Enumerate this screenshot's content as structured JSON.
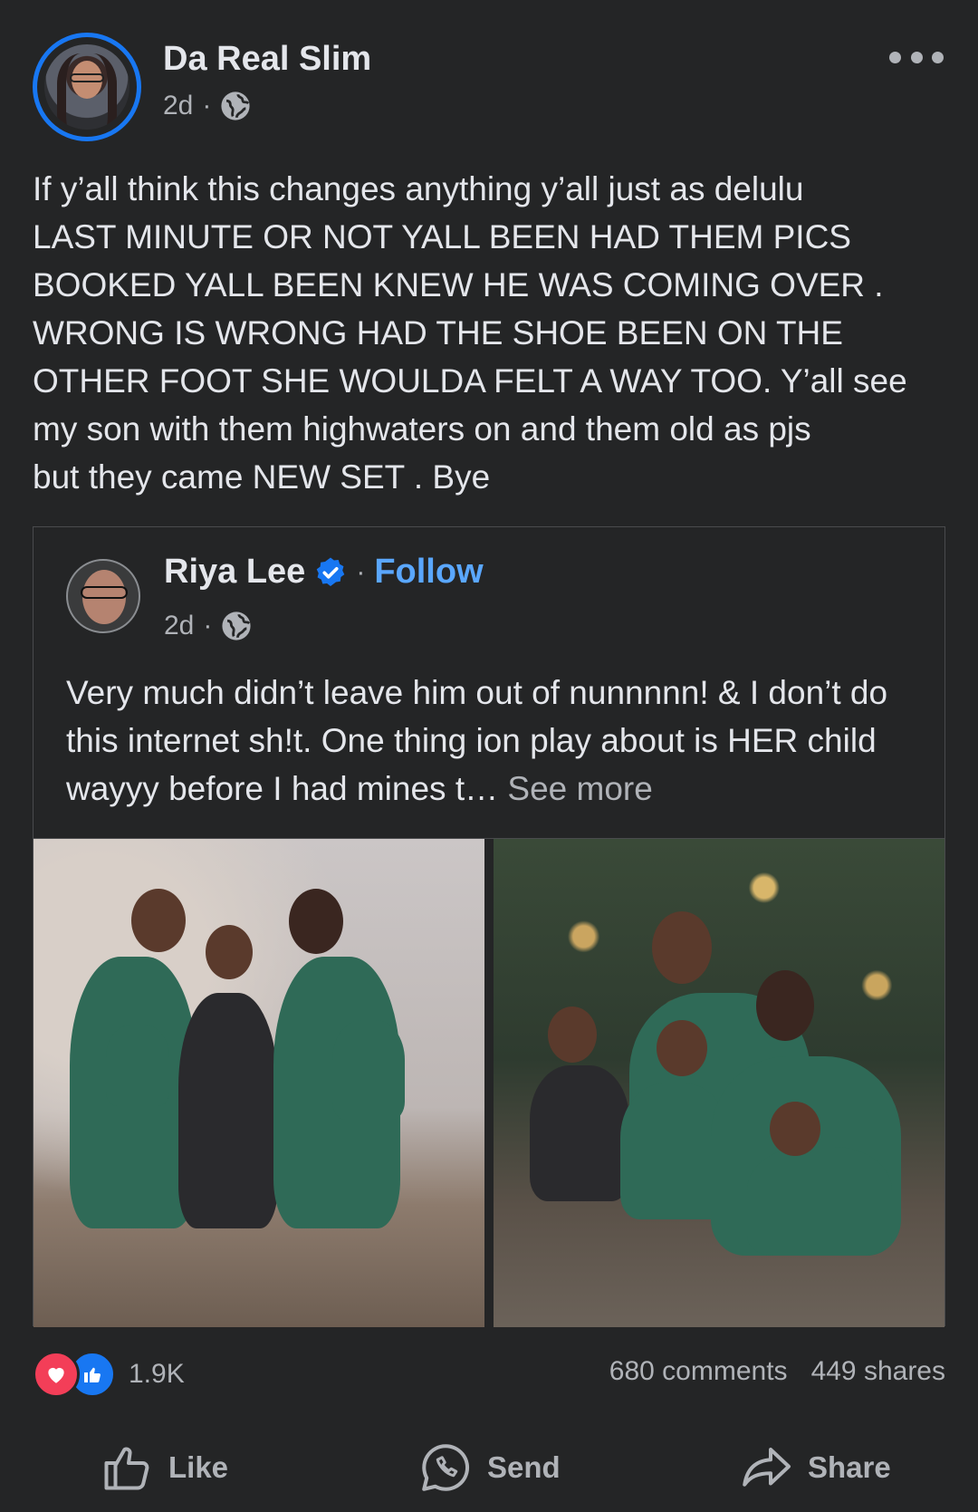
{
  "post": {
    "author": "Da Real Slim",
    "time": "2d",
    "meta_sep": "·",
    "text": "If y’all think this changes anything y’all just as delulu\nLAST MINUTE OR NOT YALL BEEN HAD THEM PICS\nBOOKED YALL BEEN KNEW HE WAS COMING OVER .\nWRONG IS WRONG HAD THE SHOE BEEN ON THE\nOTHER FOOT SHE WOULDA FELT A WAY TOO. Y’all see\nmy son with them highwaters on and them old as pjs\nbut they came NEW SET . Bye"
  },
  "shared": {
    "author": "Riya Lee",
    "separator": "·",
    "follow_label": "Follow",
    "time": "2d",
    "meta_sep": "·",
    "text": "Very much didn’t leave him out of nunnnnn! & I don’t do this internet sh!t. One thing ion play about is HER child wayyy before I had mines t…",
    "see_more": "See more"
  },
  "engagement": {
    "reaction_count": "1.9K",
    "comments": "680 comments",
    "shares": "449 shares"
  },
  "actions": {
    "like": "Like",
    "send": "Send",
    "share": "Share"
  },
  "colors": {
    "background": "#242526",
    "accent": "#1877f2",
    "follow": "#5aa7ff",
    "love": "#f33e58"
  },
  "icons": [
    "globe-icon",
    "more-icon",
    "verified-icon",
    "love-reaction-icon",
    "like-reaction-icon",
    "like-icon",
    "send-icon",
    "share-icon"
  ]
}
